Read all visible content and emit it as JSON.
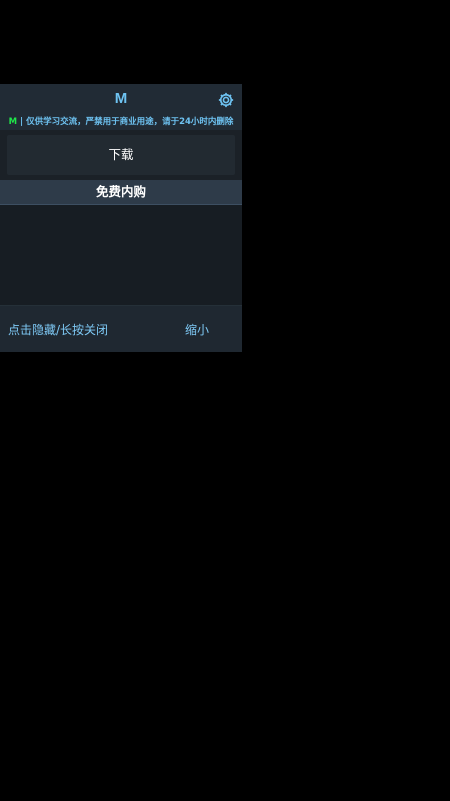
{
  "panel": {
    "title": "M",
    "notice": {
      "brand": "M",
      "separator": " | ",
      "text": "仅供学习交流，严禁用于商业用途，请于24小时内删除"
    },
    "settings_icon": "gear-icon",
    "download_label": "下载",
    "section_title": "免费内购",
    "footer": {
      "hide_label": "点击隐藏/长按关闭",
      "minimize_label": "缩小"
    }
  },
  "colors": {
    "accent": "#6ec3f2",
    "brand_green": "#1fe94a",
    "background": "#000000",
    "panel_bg": "#1b2127"
  }
}
